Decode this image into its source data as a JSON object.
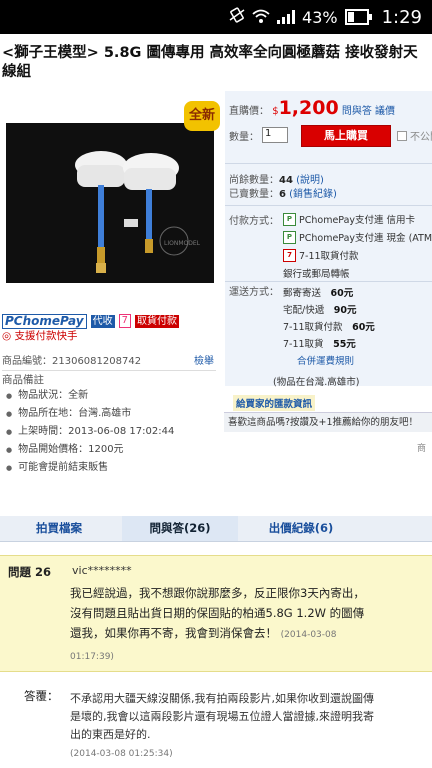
{
  "status_bar": {
    "battery": "43%",
    "time": "1:29",
    "battery_level": 0.43
  },
  "product": {
    "title": "<獅子王模型> 5.8G 圖傳專用 高效率全向圓極蘑菇 接收發射天線組",
    "badge": "全新",
    "quick_pay": "支援付款快手",
    "pay_logos": {
      "pchome": "PChomePay",
      "pchome_tag": "代收",
      "seven": "7",
      "seven_tag": "取貨付款"
    },
    "id_label": "商品編號：",
    "id": "21306081208742",
    "report": "檢舉",
    "notes_title": "商品備註",
    "notes": [
      "物品狀況：全新",
      "物品所在地：台灣.高雄市",
      "上架時間：2013-06-08 17:02:44",
      "物品開始價格：1200元",
      "可能會提前結束販售"
    ]
  },
  "purchase": {
    "price_label": "直購價：",
    "currency": "$",
    "price": "1,200",
    "price_policy": "問與答 議價",
    "qty_label": "數量：",
    "qty_value": "1",
    "buy_button": "馬上購買",
    "fav_label": "不公開",
    "remaining_label": "尚餘數量：",
    "remaining": "44",
    "remaining_link": "(說明)",
    "sold_label": "已賣數量：",
    "sold": "6",
    "sold_link": "(銷售紀錄)",
    "payment_label": "付款方式：",
    "payment_methods": [
      "PChomePay支付連 信用卡",
      "PChomePay支付連 現金 (ATM",
      "7-11取貨付款",
      "銀行或郵局轉帳"
    ],
    "shipping_label": "運送方式：",
    "shipping": [
      {
        "name": "郵寄寄送",
        "price": "60元"
      },
      {
        "name": "宅配/快遞",
        "price": "90元"
      },
      {
        "name": "7-11取貨付款",
        "price": "60元"
      },
      {
        "name": "7-11取貨",
        "price": "55元"
      }
    ],
    "combine": "合併運費規則",
    "location": "(物品在台灣.高雄市)",
    "guide": "給買家的匯款資訊",
    "like_text": "喜歡這商品嗎?按讚及+1推薦給你的朋友吧！",
    "like_tail": "商"
  },
  "tabs": [
    {
      "label": "拍買檔案"
    },
    {
      "label": "問與答(26)"
    },
    {
      "label": "出價紀錄(6)"
    }
  ],
  "qa": {
    "q_number": "問題 26",
    "q_user": "vic********",
    "q_text": "我已經說過，我不想跟你說那麼多，反正限你3天內寄出，沒有問題且貼出貨日期的保固貼的柏通5.8G 1.2W 的圖傳還我，如果你再不寄，我會到消保會去！",
    "q_time": "(2014-03-08 01:17:39)",
    "a_label": "答覆：",
    "a_text": "不承認用大疆天線沒關係,我有拍兩段影片,如果你收到還說圖傳是壞的,我會以這兩段影片還有現場五位證人當證據,來證明我寄出的東西是好的.",
    "a_time": "(2014-03-08 01:25:34)"
  }
}
